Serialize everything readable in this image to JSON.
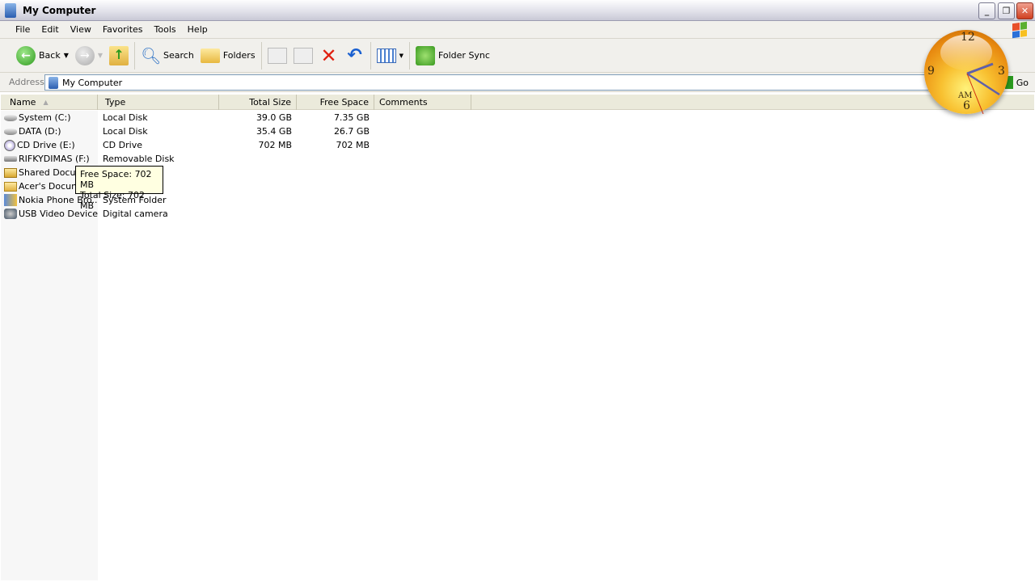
{
  "window": {
    "title": "My Computer",
    "controls": [
      "minimize",
      "restore",
      "close"
    ]
  },
  "menu": [
    "File",
    "Edit",
    "View",
    "Favorites",
    "Tools",
    "Help"
  ],
  "toolbar": {
    "back": "Back",
    "search": "Search",
    "folders": "Folders",
    "folder_sync": "Folder Sync"
  },
  "address": {
    "label": "Address",
    "value": "My Computer",
    "go": "Go"
  },
  "columns": [
    "Name",
    "Type",
    "Total Size",
    "Free Space",
    "Comments"
  ],
  "items": [
    {
      "name": "System (C:)",
      "type": "Local Disk",
      "total": "39.0 GB",
      "free": "7.35 GB",
      "icon": "hard-drive"
    },
    {
      "name": "DATA (D:)",
      "type": "Local Disk",
      "total": "35.4 GB",
      "free": "26.7 GB",
      "icon": "hard-drive"
    },
    {
      "name": "CD Drive (E:)",
      "type": "CD Drive",
      "total": "702 MB",
      "free": "702 MB",
      "icon": "cd-drive"
    },
    {
      "name": "RIFKYDIMAS (F:)",
      "type": "Removable Disk",
      "total": "",
      "free": "",
      "icon": "removable-disk"
    },
    {
      "name": "Shared Docum",
      "type": "",
      "total": "",
      "free": "",
      "icon": "shared-folder"
    },
    {
      "name": "Acer's Docume",
      "type": "",
      "total": "",
      "free": "",
      "icon": "folder"
    },
    {
      "name": "Nokia Phone Bro...",
      "type": "System Folder",
      "total": "",
      "free": "",
      "icon": "phone"
    },
    {
      "name": "USB Video Device",
      "type": "Digital camera",
      "total": "",
      "free": "",
      "icon": "camera"
    }
  ],
  "tooltip": {
    "line1": "Free Space: 702 MB",
    "line2": "Total Size: 702 MB"
  },
  "clock": {
    "numerals": [
      "12",
      "3",
      "6",
      "9"
    ],
    "ampm": "AM"
  }
}
